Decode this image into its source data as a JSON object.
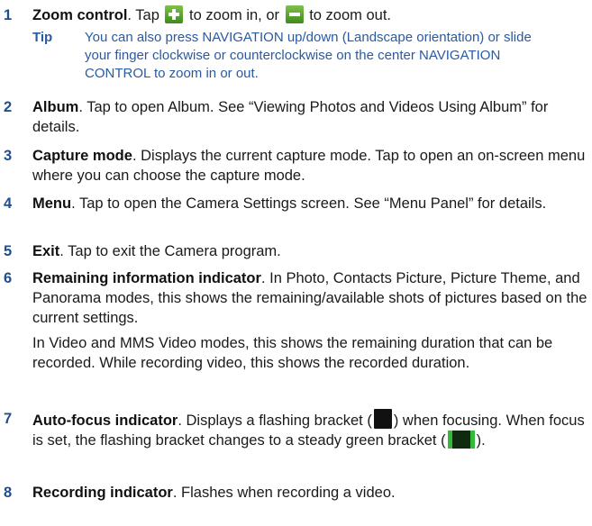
{
  "items": [
    {
      "num": "1",
      "term": "Zoom control",
      "text_a": ". Tap ",
      "plus_icon": "plus-icon",
      "text_b": " to zoom in, or ",
      "minus_icon": "minus-icon",
      "text_c": " to zoom out.",
      "tip_label": "Tip",
      "tip_text": "You can also press NAVIGATION up/down (Landscape orientation) or slide your finger clockwise or counterclockwise on the center NAVIGATION CONTROL to zoom in or out."
    },
    {
      "num": "2",
      "term": "Album",
      "text": ". Tap to open Album. See “Viewing Photos and Videos Using Album” for details."
    },
    {
      "num": "3",
      "term": "Capture mode",
      "text": ". Displays the current capture mode. Tap to open an on-screen menu where you can choose the capture mode."
    },
    {
      "num": "4",
      "term": "Menu",
      "text": ". Tap to open the Camera Settings screen. See “Menu Panel” for details."
    },
    {
      "num": "5",
      "term": "Exit",
      "text": ". Tap to exit the Camera program."
    },
    {
      "num": "6",
      "term": "Remaining information indicator",
      "text": ". In Photo, Contacts Picture, Picture Theme, and Panorama modes, this shows the remaining/available shots of pictures based on the current settings.",
      "text2": "In Video and MMS Video modes, this shows the remaining duration that can be recorded. While recording video, this shows the recorded duration."
    },
    {
      "num": "7",
      "term": "Auto-focus indicator",
      "text_a": ". Displays a flashing bracket (",
      "text_b": ") when focusing. When focus is set, the flashing bracket changes to a steady green bracket (",
      "text_c": ")."
    },
    {
      "num": "8",
      "term": "Recording indicator",
      "text": ". Flashes when recording a video."
    }
  ],
  "colors": {
    "accent": "#1f4f8f",
    "tip": "#2a5aa0",
    "icon_green": "#3f8a1c",
    "bracket_green": "#34b93a"
  }
}
